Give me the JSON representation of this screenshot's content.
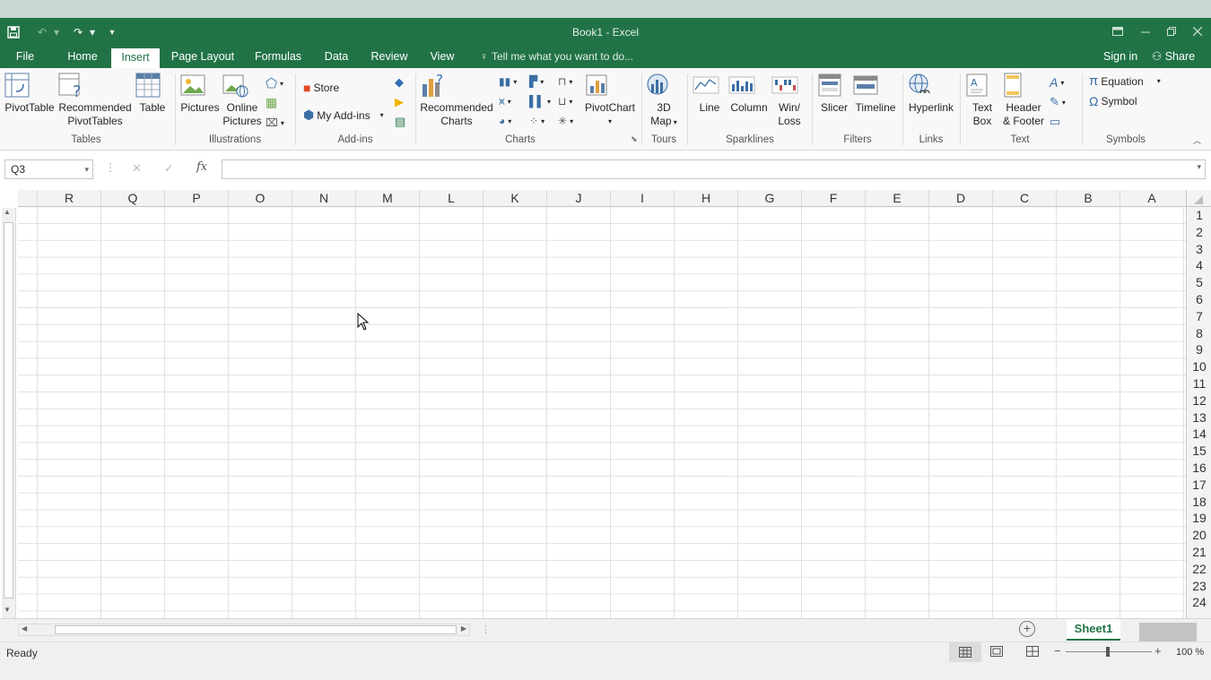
{
  "window": {
    "title": "Book1 - Excel"
  },
  "tabs": [
    {
      "label": "File"
    },
    {
      "label": "Home"
    },
    {
      "label": "Insert",
      "active": true
    },
    {
      "label": "Page Layout"
    },
    {
      "label": "Formulas"
    },
    {
      "label": "Data"
    },
    {
      "label": "Review"
    },
    {
      "label": "View"
    }
  ],
  "tellme": "Tell me what you want to do...",
  "account": {
    "signin": "Sign in",
    "share": "Share"
  },
  "ribbon": {
    "pivottable": "PivotTable",
    "recommended_pivottables": [
      "Recommended",
      "PivotTables"
    ],
    "table": "Table",
    "pictures": "Pictures",
    "online_pictures": [
      "Online",
      "Pictures"
    ],
    "store": "Store",
    "my_addins": "My Add-ins",
    "recommended_charts": [
      "Recommended",
      "Charts"
    ],
    "pivotchart": "PivotChart",
    "map3d": [
      "3D",
      "Map"
    ],
    "line": "Line",
    "column": "Column",
    "winloss": [
      "Win/",
      "Loss"
    ],
    "slicer": "Slicer",
    "timeline": "Timeline",
    "hyperlink": "Hyperlink",
    "textbox": [
      "Text",
      "Box"
    ],
    "header_footer": [
      "Header",
      "& Footer"
    ],
    "equation": "Equation",
    "symbol": "Symbol",
    "groups": {
      "tables": "Tables",
      "illustrations": "Illustrations",
      "addins": "Add-ins",
      "charts": "Charts",
      "tours": "Tours",
      "sparklines": "Sparklines",
      "filters": "Filters",
      "links": "Links",
      "text": "Text",
      "symbols": "Symbols"
    }
  },
  "namebox": "Q3",
  "fx": "fx",
  "columns": [
    "R",
    "Q",
    "P",
    "O",
    "N",
    "M",
    "L",
    "K",
    "J",
    "I",
    "H",
    "G",
    "F",
    "E",
    "D",
    "C",
    "B",
    "A"
  ],
  "rows": [
    "1",
    "2",
    "3",
    "4",
    "5",
    "6",
    "7",
    "8",
    "9",
    "10",
    "11",
    "12",
    "13",
    "14",
    "15",
    "16",
    "17",
    "18",
    "19",
    "20",
    "21",
    "22",
    "23",
    "24"
  ],
  "sheets": [
    "Sheet1"
  ],
  "status": {
    "ready": "Ready",
    "zoom": "100 %"
  },
  "colors": {
    "accent": "#217346"
  }
}
